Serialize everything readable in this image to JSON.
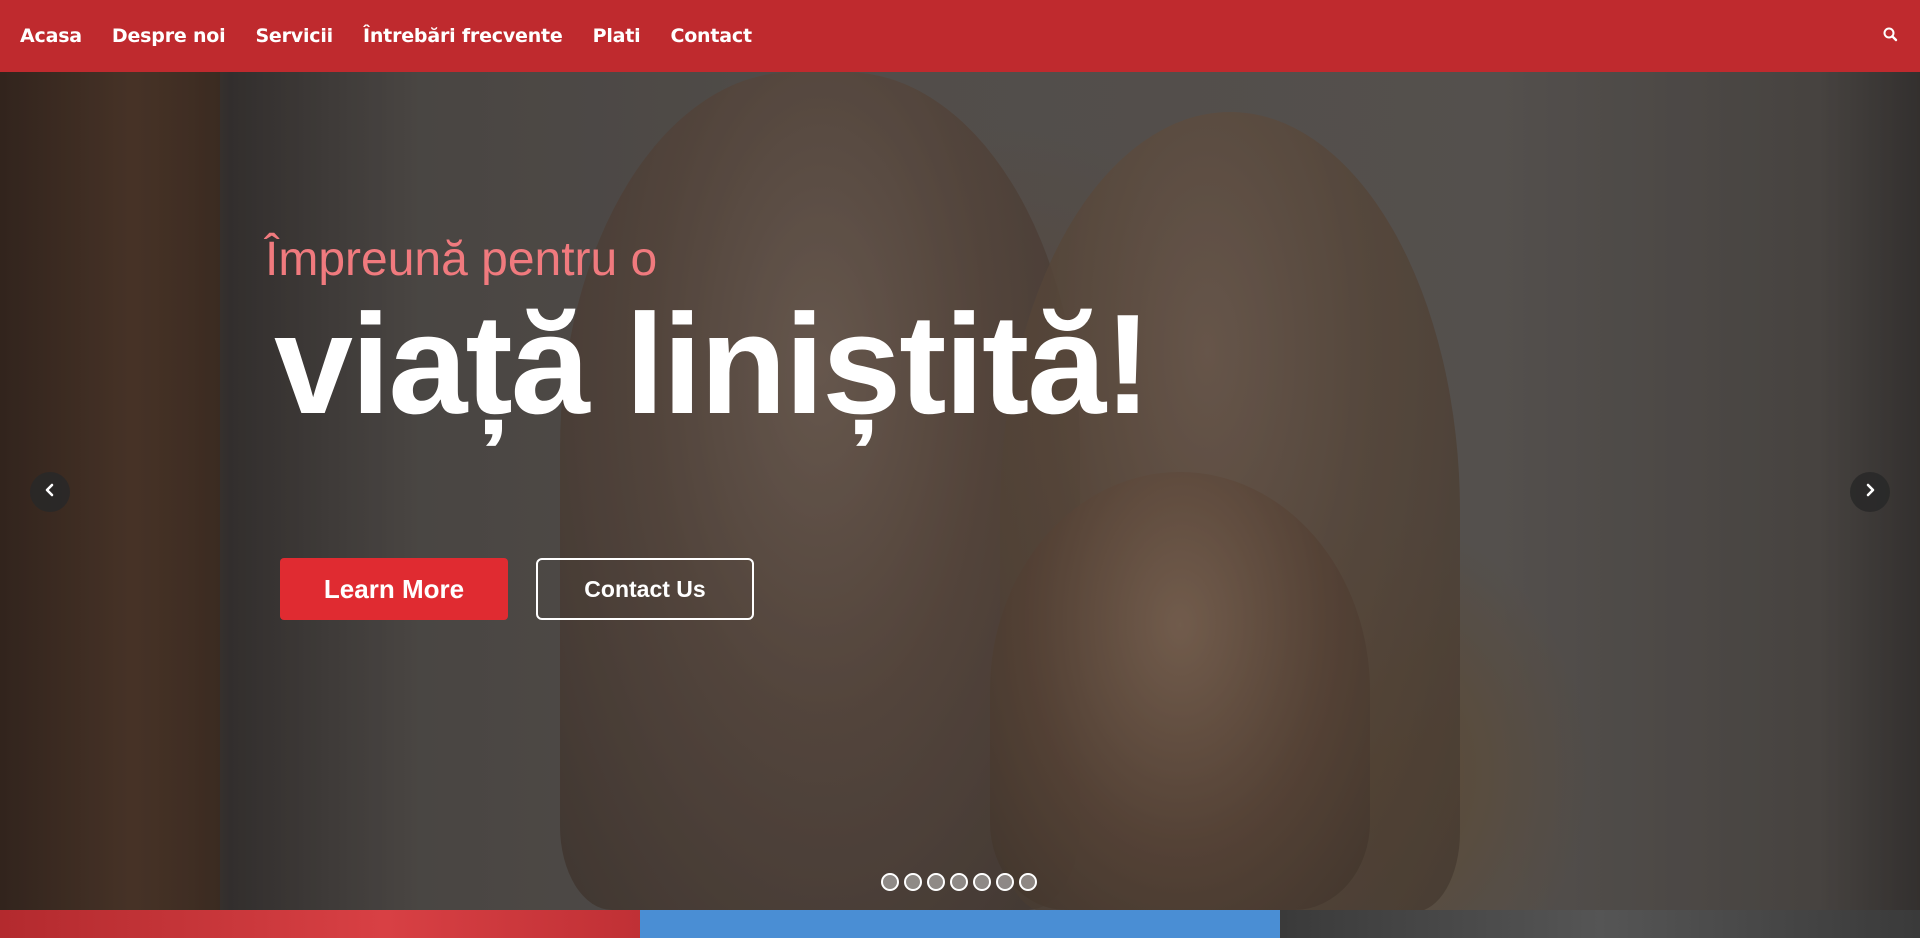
{
  "nav": {
    "items": [
      {
        "label": "Acasa"
      },
      {
        "label": "Despre noi"
      },
      {
        "label": "Servicii"
      },
      {
        "label": "Întrebări frecvente"
      },
      {
        "label": "Plati"
      },
      {
        "label": "Contact"
      }
    ],
    "search_icon": "search-icon"
  },
  "hero": {
    "subtitle": "Împreună pentru o",
    "title": "viață liniștită!",
    "primary_button": "Learn More",
    "secondary_button": "Contact Us",
    "prev_icon": "chevron-left-icon",
    "next_icon": "chevron-right-icon",
    "slide_count": 7
  },
  "colors": {
    "nav_bg": "#bf2a2e",
    "accent": "#e02b31",
    "subtitle": "#f07a7e",
    "strip_blue": "#4a8ed4"
  }
}
